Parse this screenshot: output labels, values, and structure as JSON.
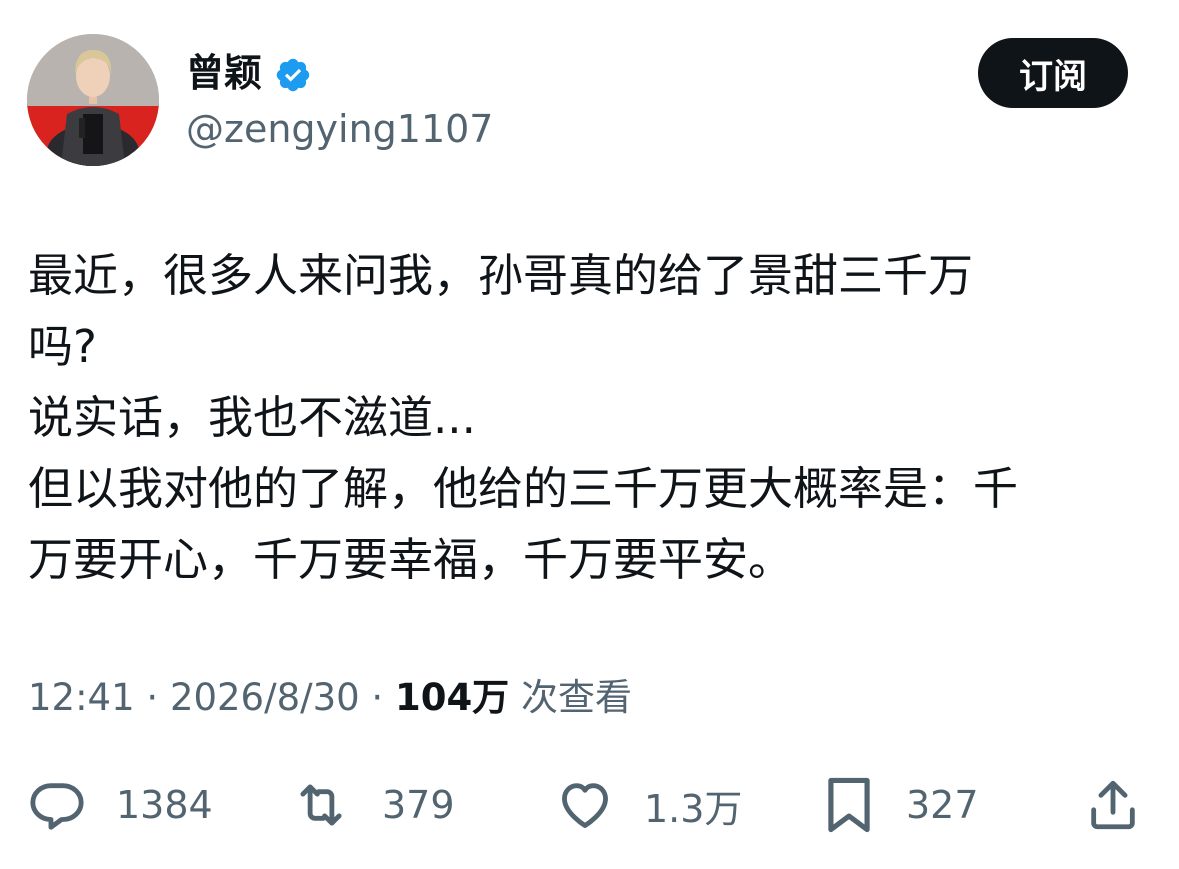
{
  "user": {
    "display_name": "曾颖",
    "handle": "@zengying1107",
    "verified_icon": "verified-badge-icon",
    "verified_color": "#1d9bf0"
  },
  "subscribe_label": "订阅",
  "tweet": {
    "lines": [
      "最近，很多人来问我，孙哥真的给了景甜三千万",
      "吗?",
      "说实话，我也不滋道...",
      "但以我对他的了解，他给的三千万更大概率是：千",
      "万要开心，千万要幸福，千万要平安。"
    ]
  },
  "meta": {
    "time": "12:41",
    "sep1": "·",
    "date": "2026/8/30",
    "sep2": "·",
    "views_count": "104万",
    "views_label": "次查看"
  },
  "actions": {
    "reply": {
      "icon": "reply-icon",
      "count": "1384"
    },
    "retweet": {
      "icon": "retweet-icon",
      "count": "379"
    },
    "like": {
      "icon": "heart-icon",
      "count": "1.3万"
    },
    "bookmark": {
      "icon": "bookmark-icon",
      "count": "327"
    },
    "share": {
      "icon": "share-icon"
    }
  },
  "colors": {
    "text_primary": "#0f1419",
    "text_secondary": "#536471",
    "button_bg": "#0f1419"
  }
}
